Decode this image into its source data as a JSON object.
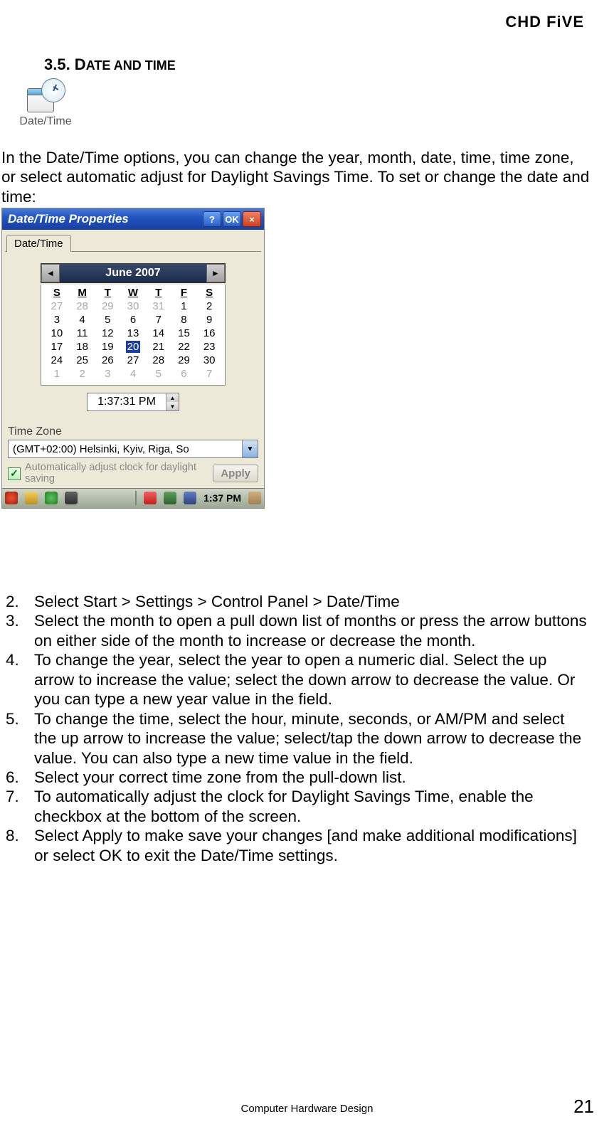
{
  "header_brand": "CHD FiVE",
  "section_heading_prefix": "3.5. D",
  "section_heading_rest": "ATE AND TIME",
  "dt_icon_label": "Date/Time",
  "intro_text": "In the Date/Time options, you can change the year, month, date, time, time zone, or select automatic adjust for Daylight Savings Time. To set or change the date and time:",
  "dialog": {
    "title": "Date/Time Properties",
    "help_btn": "?",
    "ok_btn": "OK",
    "close_btn": "×",
    "tab_label": "Date/Time",
    "month_label": "June 2007",
    "dow": [
      "S",
      "M",
      "T",
      "W",
      "T",
      "F",
      "S"
    ],
    "rows": [
      [
        {
          "v": "27",
          "d": true
        },
        {
          "v": "28",
          "d": true
        },
        {
          "v": "29",
          "d": true
        },
        {
          "v": "30",
          "d": true
        },
        {
          "v": "31",
          "d": true
        },
        {
          "v": "1"
        },
        {
          "v": "2"
        }
      ],
      [
        {
          "v": "3"
        },
        {
          "v": "4"
        },
        {
          "v": "5"
        },
        {
          "v": "6"
        },
        {
          "v": "7"
        },
        {
          "v": "8"
        },
        {
          "v": "9"
        }
      ],
      [
        {
          "v": "10"
        },
        {
          "v": "11"
        },
        {
          "v": "12"
        },
        {
          "v": "13"
        },
        {
          "v": "14"
        },
        {
          "v": "15"
        },
        {
          "v": "16"
        }
      ],
      [
        {
          "v": "17"
        },
        {
          "v": "18"
        },
        {
          "v": "19"
        },
        {
          "v": "20",
          "sel": true
        },
        {
          "v": "21"
        },
        {
          "v": "22"
        },
        {
          "v": "23"
        }
      ],
      [
        {
          "v": "24"
        },
        {
          "v": "25"
        },
        {
          "v": "26"
        },
        {
          "v": "27"
        },
        {
          "v": "28"
        },
        {
          "v": "29"
        },
        {
          "v": "30"
        }
      ],
      [
        {
          "v": "1",
          "d": true
        },
        {
          "v": "2",
          "d": true
        },
        {
          "v": "3",
          "d": true
        },
        {
          "v": "4",
          "d": true
        },
        {
          "v": "5",
          "d": true
        },
        {
          "v": "6",
          "d": true
        },
        {
          "v": "7",
          "d": true
        }
      ]
    ],
    "time_value": "1:37:31 PM",
    "tz_label": "Time Zone",
    "tz_value": "(GMT+02:00) Helsinki, Kyiv, Riga, So",
    "dst_text": "Automatically adjust clock for daylight saving",
    "apply_label": "Apply",
    "taskbar_time": "1:37 PM"
  },
  "steps": [
    {
      "n": "2.",
      "t": "Select Start > Settings > Control Panel > Date/Time"
    },
    {
      "n": "3.",
      "t": "Select the month to open a pull down list of months or press the arrow buttons on either side of the month to increase or decrease the month."
    },
    {
      "n": "4.",
      "t": "To change the year, select the year to open a numeric dial. Select the up arrow to increase the value; select the down arrow to decrease the value. Or you can type a new year value in the field."
    },
    {
      "n": "5.",
      "t": "To change the time, select the hour, minute, seconds, or AM/PM and select the up arrow to increase the value; select/tap the down arrow to decrease the value. You can also type a new time value in the field."
    },
    {
      "n": "6.",
      "t": "Select your correct time zone from the pull-down list."
    },
    {
      "n": "7.",
      "t": "To automatically adjust the clock for Daylight Savings Time, enable the checkbox at the bottom of the screen."
    },
    {
      "n": "8.",
      "t": "Select Apply to make save your changes [and make additional modifications] or select OK to exit the Date/Time settings."
    }
  ],
  "footer_text": "Computer Hardware Design",
  "page_number": "21"
}
